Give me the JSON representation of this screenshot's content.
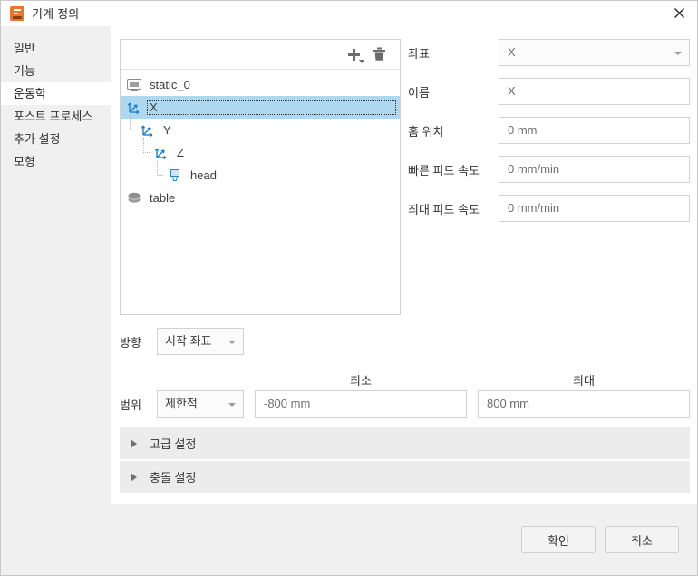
{
  "window": {
    "title": "기계 정의",
    "app_icon": "fusion-icon",
    "close_icon": "close-icon",
    "accent_color": "#e8762c"
  },
  "sidebar": {
    "items": [
      {
        "label": "일반",
        "active": false
      },
      {
        "label": "기능",
        "active": false
      },
      {
        "label": "운동학",
        "active": true
      },
      {
        "label": "포스트 프로세스",
        "active": false
      },
      {
        "label": "추가 설정",
        "active": false
      },
      {
        "label": "모형",
        "active": false
      }
    ]
  },
  "tree": {
    "toolbar": {
      "add_icon": "plus-icon",
      "add_dropdown_icon": "chevron-down-icon",
      "delete_icon": "trash-icon"
    },
    "selection_color": "#add8ef",
    "nodes": [
      {
        "label": "static_0",
        "icon": "machine-base-icon",
        "depth": 0,
        "selected": false
      },
      {
        "label": "X",
        "icon": "axis-icon",
        "depth": 0,
        "selected": true
      },
      {
        "label": "Y",
        "icon": "axis-icon",
        "depth": 1,
        "selected": false
      },
      {
        "label": "Z",
        "icon": "axis-icon",
        "depth": 2,
        "selected": false
      },
      {
        "label": "head",
        "icon": "spindle-head-icon",
        "depth": 3,
        "selected": false
      },
      {
        "label": "table",
        "icon": "table-disc-icon",
        "depth": 0,
        "selected": false
      }
    ]
  },
  "fields": [
    {
      "label": "좌표",
      "value": "X",
      "type": "select"
    },
    {
      "label": "이름",
      "value": "X",
      "type": "text"
    },
    {
      "label": "홈 위치",
      "value": "0 mm",
      "type": "text"
    },
    {
      "label": "빠른 피드 속도",
      "value": "0 mm/min",
      "type": "text"
    },
    {
      "label": "최대 피드 속도",
      "value": "0 mm/min",
      "type": "text"
    }
  ],
  "direction": {
    "label": "방향",
    "value": "시작 좌표"
  },
  "range": {
    "label": "범위",
    "mode": "제한적",
    "min_header": "최소",
    "max_header": "최대",
    "min_value": "-800 mm",
    "max_value": "800 mm"
  },
  "sections": [
    {
      "label": "고급 설정",
      "expanded": false,
      "icon": "triangle-right-icon"
    },
    {
      "label": "충돌 설정",
      "expanded": false,
      "icon": "triangle-right-icon"
    }
  ],
  "footer": {
    "ok_label": "확인",
    "cancel_label": "취소"
  }
}
